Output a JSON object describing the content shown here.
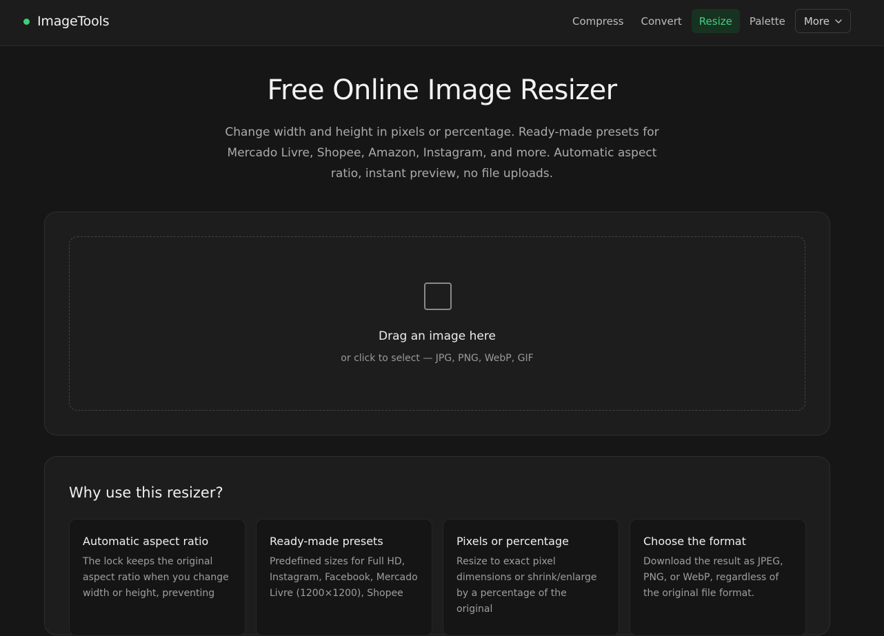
{
  "header": {
    "brand": "ImageTools",
    "nav": [
      {
        "label": "Compress",
        "active": false
      },
      {
        "label": "Convert",
        "active": false
      },
      {
        "label": "Resize",
        "active": true
      },
      {
        "label": "Palette",
        "active": false
      }
    ],
    "more_label": "More",
    "accent_color": "#3ecf7c"
  },
  "hero": {
    "title": "Free Online Image Resizer",
    "subtitle": "Change width and height in pixels or percentage. Ready-made presets for Mercado Livre, Shopee, Amazon, Instagram, and more. Automatic aspect ratio, instant preview, no file uploads."
  },
  "upload": {
    "icon": "image-icon",
    "title": "Drag an image here",
    "subtitle": "or click to select — JPG, PNG, WebP, GIF"
  },
  "why": {
    "title": "Why use this resizer?",
    "features": [
      {
        "title": "Automatic aspect ratio",
        "desc": "The lock keeps the original aspect ratio when you change width or height, preventing"
      },
      {
        "title": "Ready-made presets",
        "desc": "Predefined sizes for Full HD, Instagram, Facebook, Mercado Livre (1200×1200), Shopee"
      },
      {
        "title": "Pixels or percentage",
        "desc": "Resize to exact pixel dimensions or shrink/enlarge by a percentage of the original"
      },
      {
        "title": "Choose the format",
        "desc": "Download the result as JPEG, PNG, or WebP, regardless of the original file format."
      }
    ]
  }
}
